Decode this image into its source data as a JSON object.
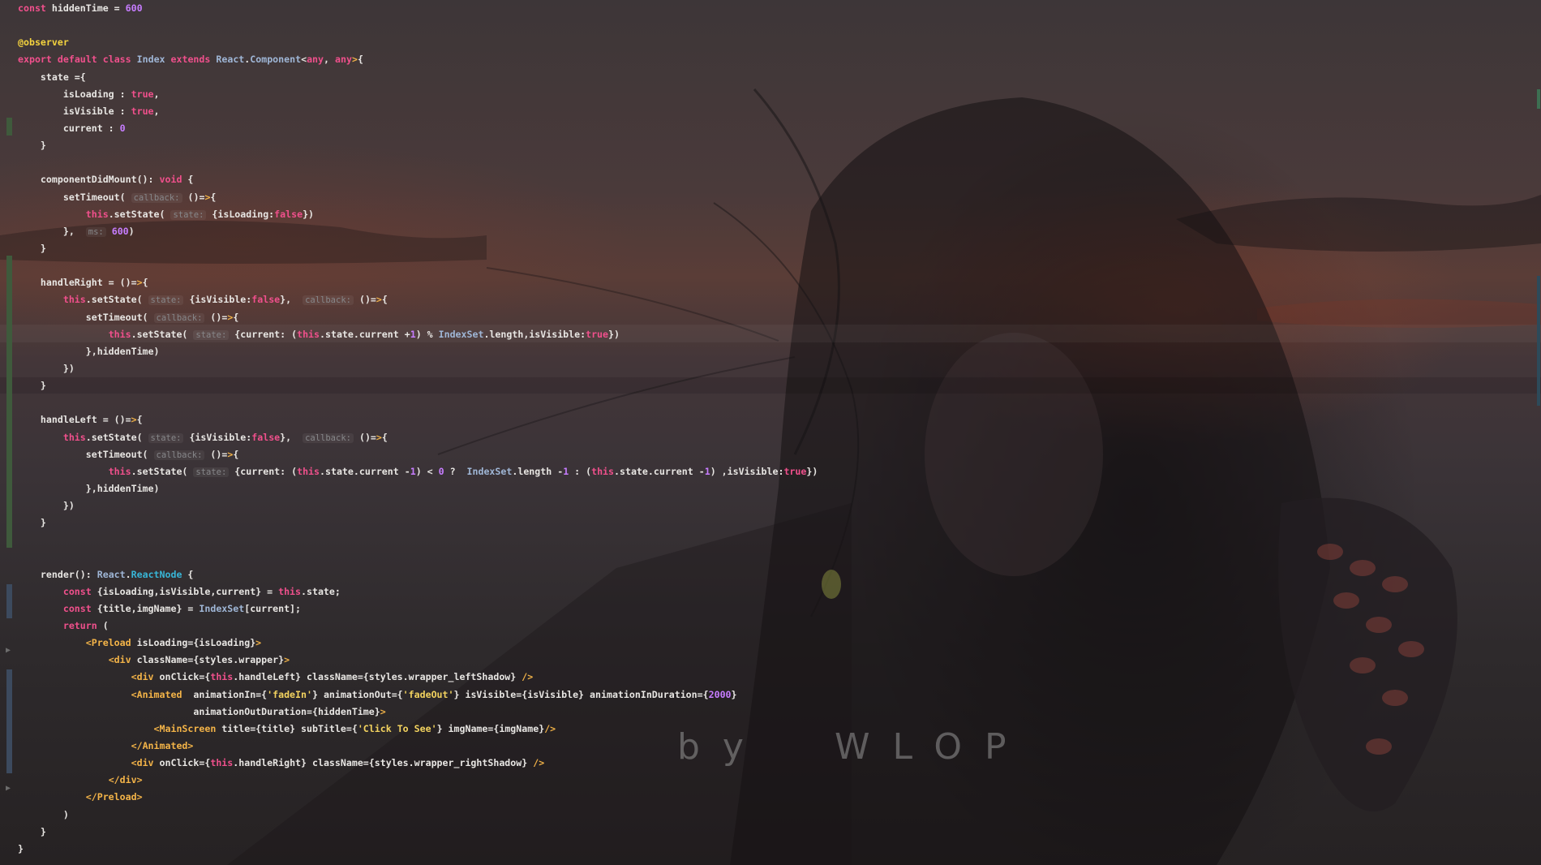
{
  "editor": {
    "watermark": "by  WLOP",
    "hint_labels": {
      "callback": "callback:",
      "state": "state:",
      "ms": "ms:"
    }
  },
  "code_lines": [
    "const hiddenTime = 600",
    "",
    "@observer",
    "export default class Index extends React.Component<any, any>{",
    "    state ={",
    "        isLoading : true,",
    "        isVisible : true,",
    "        current : 0",
    "    }",
    "",
    "    componentDidMount(): void {",
    "        setTimeout( callback: ()=>{",
    "            this.setState( state: {isLoading:false})",
    "        },  ms: 600)",
    "    }",
    "",
    "    handleRight = ()=>{",
    "        this.setState( state: {isVisible:false},  callback: ()=>{",
    "            setTimeout( callback: ()=>{",
    "                this.setState( state: {current: (this.state.current +1) % IndexSet.length,isVisible:true})",
    "            },hiddenTime)",
    "        })",
    "    }",
    "",
    "    handleLeft = ()=>{",
    "        this.setState( state: {isVisible:false},  callback: ()=>{",
    "            setTimeout( callback: ()=>{",
    "                this.setState( state: {current: (this.state.current -1) < 0 ?  IndexSet.length -1 : (this.state.current -1) ,isVisible:true})",
    "            },hiddenTime)",
    "        })",
    "    }",
    "",
    "",
    "    render(): React.ReactNode {",
    "        const {isLoading,isVisible,current} = this.state;",
    "        const {title,imgName} = IndexSet[current];",
    "        return (",
    "            <Preload isLoading={isLoading}>",
    "                <div className={styles.wrapper}>",
    "                    <div onClick={this.handleLeft} className={styles.wrapper_leftShadow} />",
    "                    <Animated  animationIn={'fadeIn'} animationOut={'fadeOut'} isVisible={isVisible} animationInDuration={2000}",
    "                               animationOutDuration={hiddenTime}>",
    "                        <MainScreen title={title} subTitle={'Click To See'} imgName={imgName}/>",
    "                    </Animated>",
    "                    <div onClick={this.handleRight} className={styles.wrapper_rightShadow} />",
    "                </div>",
    "            </Preload>",
    "        )",
    "    }",
    "}"
  ],
  "colors": {
    "keyword": "#f0508c",
    "number": "#c77dff",
    "string": "#f3d35f",
    "jsx_tag": "#f4b448",
    "type": "#9fb6d6",
    "type_highlight": "#38b6d7",
    "annotation": "#f4d33e",
    "text": "#e8e6e3",
    "inlay_hint": "#87878a"
  }
}
